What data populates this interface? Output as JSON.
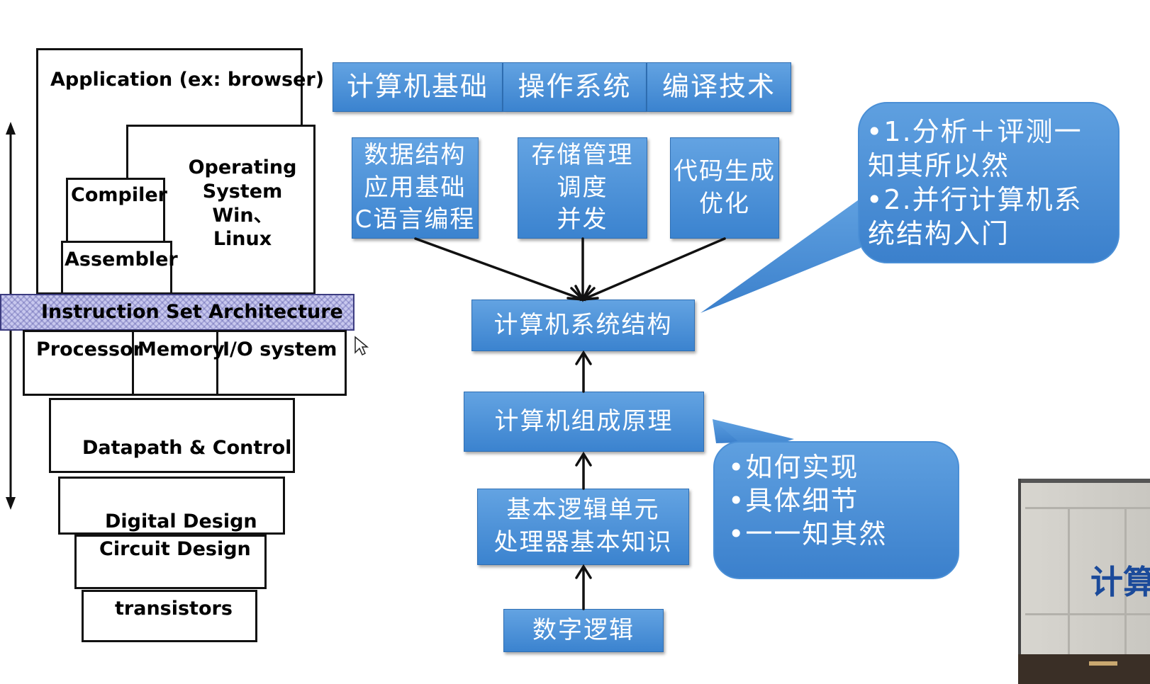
{
  "stack": {
    "application": "Application (ex: browser)",
    "operating_system": "Operating\nSystem\nWin、Linux",
    "compiler": "Compiler",
    "assembler": "Assembler",
    "isa": "Instruction  Set Architecture",
    "processor": "Processor",
    "memory": "Memory",
    "io_system": "I/O system",
    "datapath_control": "Datapath  &  Control",
    "digital_design": "Digital  Design",
    "circuit_design": "Circuit Design",
    "transistors": "transistors"
  },
  "flow": {
    "top_bar": [
      "计算机基础",
      "操作系统",
      "编译技术"
    ],
    "row2": [
      "数据结构\n应用基础\nC语言编程",
      "存储管理\n调度\n并发",
      "代码生成\n优化"
    ],
    "architecture": "计算机系统结构",
    "organization": "计算机组成原理",
    "logic_unit": "基本逻辑单元\n处理器基本知识",
    "digital_logic": "数字逻辑"
  },
  "callouts": {
    "top": [
      "•1.分析＋评测一",
      "知其所以然",
      "•2.并行计算机系",
      "统结构入门"
    ],
    "bottom": [
      "•如何实现",
      "•具体细节",
      "•一一知其然"
    ]
  },
  "thumbnail": {
    "partial_text": "计算"
  },
  "colors": {
    "box_blue": "#4a90d9",
    "box_border": "#2f6fb4",
    "isa_fill": "#c8c8ee"
  }
}
